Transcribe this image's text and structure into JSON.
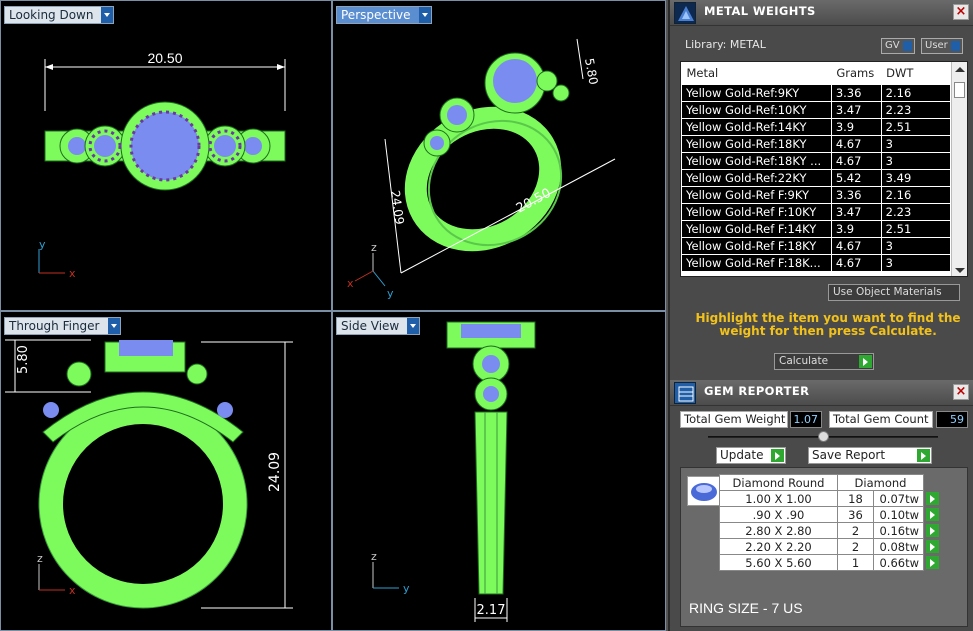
{
  "viewports": {
    "top_left": {
      "label": "Looking Down",
      "dimension_width": "20.50"
    },
    "top_right": {
      "label": "Perspective",
      "dim_a": "5.80",
      "dim_b": "24.09",
      "dim_c": "20.50"
    },
    "bottom_left": {
      "label": "Through Finger",
      "dim_a": "5.80",
      "dim_b": "24.09"
    },
    "bottom_right": {
      "label": "Side View",
      "dim_a": "2.17"
    },
    "axes": {
      "x": "x",
      "y": "y",
      "z": "z"
    }
  },
  "metal_weights": {
    "title": "METAL WEIGHTS",
    "library_label": "Library: METAL",
    "toggle_gv": "GV",
    "toggle_user": "User",
    "columns": [
      "Metal",
      "Grams",
      "DWT"
    ],
    "rows": [
      [
        "Yellow Gold-Ref:9KY",
        "3.36",
        "2.16"
      ],
      [
        "Yellow Gold-Ref:10KY",
        "3.47",
        "2.23"
      ],
      [
        "Yellow Gold-Ref:14KY",
        "3.9",
        "2.51"
      ],
      [
        "Yellow Gold-Ref:18KY",
        "4.67",
        "3"
      ],
      [
        "Yellow Gold-Ref:18KY ...",
        "4.67",
        "3"
      ],
      [
        "Yellow Gold-Ref:22KY",
        "5.42",
        "3.49"
      ],
      [
        "Yellow Gold-Ref F:9KY",
        "3.36",
        "2.16"
      ],
      [
        "Yellow Gold-Ref F:10KY",
        "3.47",
        "2.23"
      ],
      [
        "Yellow Gold-Ref F:14KY",
        "3.9",
        "2.51"
      ],
      [
        "Yellow Gold-Ref F:18KY",
        "4.67",
        "3"
      ],
      [
        "Yellow Gold-Ref F:18K...",
        "4.67",
        "3"
      ]
    ],
    "use_object_materials": "Use Object Materials",
    "hint": "Highlight the item you want to find the weight for then press Calculate.",
    "calculate_label": "Calculate"
  },
  "gem_reporter": {
    "title": "GEM REPORTER",
    "total_weight_label": "Total Gem Weight",
    "total_weight_value": "1.07",
    "total_count_label": "Total Gem Count",
    "total_count_value": "59",
    "update_label": "Update",
    "save_report_label": "Save Report",
    "table_headers": [
      "Diamond Round",
      "Diamond"
    ],
    "rows": [
      [
        "1.00 X 1.00",
        "18",
        "0.07tw"
      ],
      [
        ".90 X .90",
        "36",
        "0.10tw"
      ],
      [
        "2.80 X 2.80",
        "2",
        "0.16tw"
      ],
      [
        "2.20 X 2.20",
        "2",
        "0.08tw"
      ],
      [
        "5.60 X 5.60",
        "1",
        "0.66tw"
      ]
    ],
    "ring_size": "RING SIZE - 7 US"
  },
  "colors": {
    "ring_green": "#7dfa5c",
    "gem_blue": "#7a8cf0",
    "accent_gold": "#f2c21b",
    "action_green": "#2fa832"
  }
}
